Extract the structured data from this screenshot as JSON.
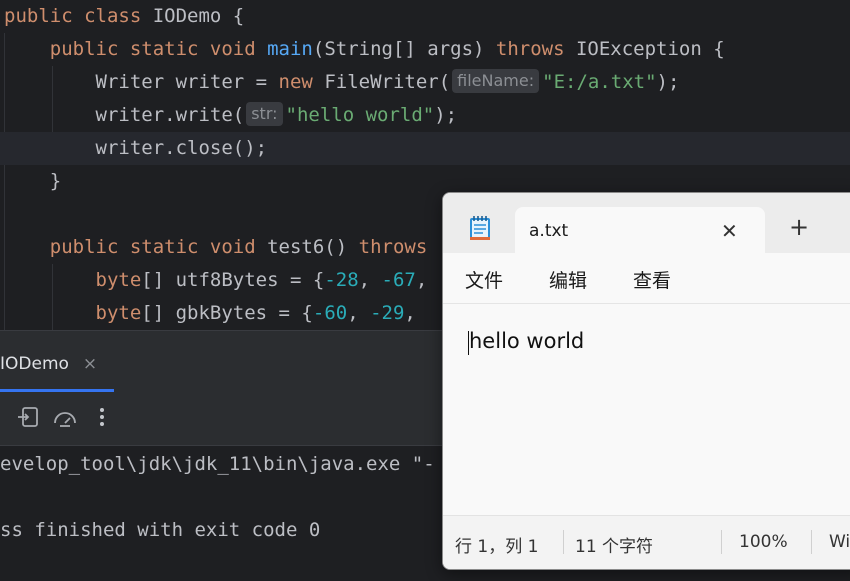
{
  "editor": {
    "lines": [
      {
        "tokens": [
          {
            "t": "kw",
            "v": "public class "
          },
          {
            "t": "plain",
            "v": "IODemo {"
          }
        ]
      },
      {
        "tokens": [
          {
            "t": "plain",
            "v": "    "
          },
          {
            "t": "kw",
            "v": "public static void "
          },
          {
            "t": "fn",
            "v": "main"
          },
          {
            "t": "plain",
            "v": "(String[] args) "
          },
          {
            "t": "kw",
            "v": "throws "
          },
          {
            "t": "plain",
            "v": "IOException {"
          }
        ]
      },
      {
        "tokens": [
          {
            "t": "plain",
            "v": "        Writer writer = "
          },
          {
            "t": "kw",
            "v": "new "
          },
          {
            "t": "plain",
            "v": "FileWriter("
          },
          {
            "t": "hint",
            "v": "fileName:"
          },
          {
            "t": "str",
            "v": "\"E:/a.txt\""
          },
          {
            "t": "plain",
            "v": ");"
          }
        ]
      },
      {
        "tokens": [
          {
            "t": "plain",
            "v": "        writer.write("
          },
          {
            "t": "hint",
            "v": "str:"
          },
          {
            "t": "str",
            "v": "\"hello world\""
          },
          {
            "t": "plain",
            "v": ");"
          }
        ]
      },
      {
        "tokens": [
          {
            "t": "plain",
            "v": "        writer.close();"
          }
        ]
      },
      {
        "tokens": [
          {
            "t": "plain",
            "v": "    }"
          }
        ]
      },
      {
        "tokens": []
      },
      {
        "tokens": [
          {
            "t": "plain",
            "v": "    "
          },
          {
            "t": "kw",
            "v": "public static void "
          },
          {
            "t": "plain",
            "v": "test6() "
          },
          {
            "t": "kw",
            "v": "throws"
          }
        ]
      },
      {
        "tokens": [
          {
            "t": "plain",
            "v": "        "
          },
          {
            "t": "kw",
            "v": "byte"
          },
          {
            "t": "plain",
            "v": "[] utf8Bytes = {"
          },
          {
            "t": "num",
            "v": "-28"
          },
          {
            "t": "plain",
            "v": ", "
          },
          {
            "t": "num",
            "v": "-67"
          },
          {
            "t": "plain",
            "v": ","
          }
        ]
      },
      {
        "tokens": [
          {
            "t": "plain",
            "v": "        "
          },
          {
            "t": "kw",
            "v": "byte"
          },
          {
            "t": "plain",
            "v": "[] gbkBytes = {"
          },
          {
            "t": "num",
            "v": "-60"
          },
          {
            "t": "plain",
            "v": ", "
          },
          {
            "t": "num",
            "v": "-29"
          },
          {
            "t": "plain",
            "v": ","
          }
        ]
      }
    ],
    "current_line": 4
  },
  "run_panel": {
    "tab_label": "IODemo",
    "tab_close": "×",
    "toolbar_icons": [
      "restore-layout-icon",
      "gauge-icon",
      "more-vertical-icon"
    ],
    "console_lines": [
      "evelop_tool\\jdk\\jdk_11\\bin\\java.exe \"-",
      "",
      "ss finished with exit code 0"
    ]
  },
  "notepad": {
    "tab_title": "a.txt",
    "tab_close": "✕",
    "new_tab": "+",
    "menu": [
      "文件",
      "编辑",
      "查看"
    ],
    "content": "hello world",
    "status": {
      "position": "行 1，列 1",
      "char_count": "11 个字符",
      "zoom": "100%",
      "line_ending": "Wi"
    }
  },
  "colors": {
    "keyword": "#cf8e6d",
    "function": "#56a8f5",
    "string": "#6aab73",
    "number": "#2aacb8",
    "accent": "#3574f0"
  }
}
